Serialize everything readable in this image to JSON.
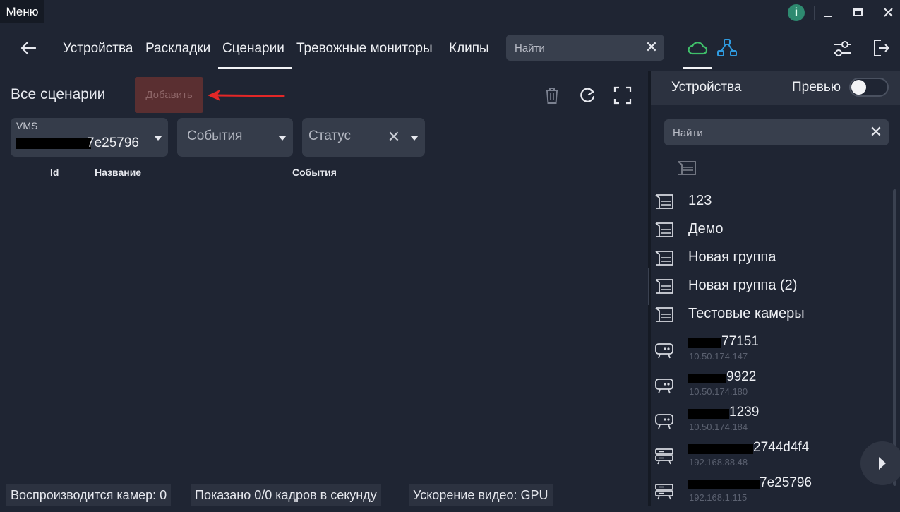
{
  "titlebar": {
    "menu_label": "Меню",
    "info_label": "i",
    "minimize_label": "—",
    "maximize_label": "□",
    "close_label": "✕"
  },
  "nav": {
    "tabs": [
      {
        "label": "Устройства"
      },
      {
        "label": "Раскладки"
      },
      {
        "label": "Сценарии",
        "active": true
      },
      {
        "label": "Тревожные мониторы"
      },
      {
        "label": "Клипы"
      }
    ],
    "search": {
      "placeholder": "Найти",
      "clear_label": "✕"
    },
    "icons": [
      "back-arrow-icon",
      "cloud-icon",
      "network-icon",
      "settings-sliders-icon",
      "logout-icon"
    ],
    "accent_color": "#3fbf6a"
  },
  "main": {
    "title": "Все сценарии",
    "add_label": "Добавить",
    "filters": {
      "vms": {
        "label": "VMS",
        "value": "7e25796"
      },
      "events": {
        "label": "События"
      },
      "status": {
        "label": "Статус",
        "clear_label": "✕"
      }
    },
    "columns": [
      {
        "label": "Id"
      },
      {
        "label": "Название"
      },
      {
        "label": "События"
      }
    ]
  },
  "statusbar": {
    "cameras": "Воспроизводится камер: 0",
    "frames": "Показано 0/0 кадров в секунду",
    "acceleration": "Ускорение видео: GPU"
  },
  "devices_panel": {
    "title": "Устройства",
    "preview_label": "Превью",
    "preview_on": false,
    "search": {
      "placeholder": "Найти",
      "clear_label": "✕"
    },
    "groups": [
      {
        "label": "123"
      },
      {
        "label": "Демо"
      },
      {
        "label": "Новая группа"
      },
      {
        "label": "Новая группа (2)"
      },
      {
        "label": "Тестовые камеры"
      }
    ],
    "cameras": [
      {
        "name": "77151",
        "ip": "10.50.174.147",
        "kind": "camera"
      },
      {
        "name": "9922",
        "ip": "10.50.174.180",
        "kind": "camera"
      },
      {
        "name": "1239",
        "ip": "10.50.174.184",
        "kind": "camera"
      },
      {
        "name": "2744d4f4",
        "ip": "192.168.88.48",
        "kind": "server"
      },
      {
        "name": "7e25796",
        "ip": "192.168.1.115",
        "kind": "server"
      }
    ]
  }
}
